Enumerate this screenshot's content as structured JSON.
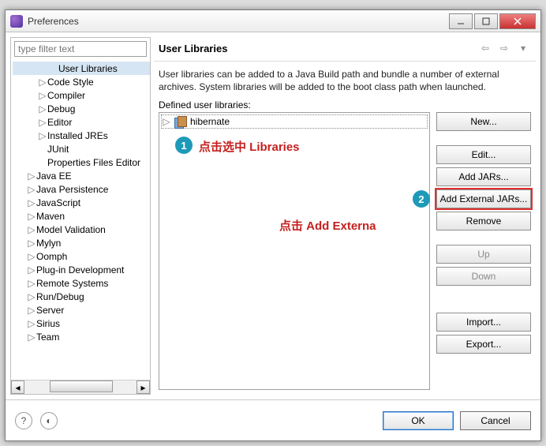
{
  "window": {
    "title": "Preferences"
  },
  "filter": {
    "placeholder": "type filter text"
  },
  "tree": {
    "items": [
      {
        "indent": 3,
        "tw": "",
        "label": "User Libraries",
        "sel": true
      },
      {
        "indent": 2,
        "tw": "▷",
        "label": "Code Style"
      },
      {
        "indent": 2,
        "tw": "▷",
        "label": "Compiler"
      },
      {
        "indent": 2,
        "tw": "▷",
        "label": "Debug"
      },
      {
        "indent": 2,
        "tw": "▷",
        "label": "Editor"
      },
      {
        "indent": 2,
        "tw": "▷",
        "label": "Installed JREs"
      },
      {
        "indent": 2,
        "tw": "",
        "label": "JUnit"
      },
      {
        "indent": 2,
        "tw": "",
        "label": "Properties Files Editor"
      },
      {
        "indent": 1,
        "tw": "▷",
        "label": "Java EE"
      },
      {
        "indent": 1,
        "tw": "▷",
        "label": "Java Persistence"
      },
      {
        "indent": 1,
        "tw": "▷",
        "label": "JavaScript"
      },
      {
        "indent": 1,
        "tw": "▷",
        "label": "Maven"
      },
      {
        "indent": 1,
        "tw": "▷",
        "label": "Model Validation"
      },
      {
        "indent": 1,
        "tw": "▷",
        "label": "Mylyn"
      },
      {
        "indent": 1,
        "tw": "▷",
        "label": "Oomph"
      },
      {
        "indent": 1,
        "tw": "▷",
        "label": "Plug-in Development"
      },
      {
        "indent": 1,
        "tw": "▷",
        "label": "Remote Systems"
      },
      {
        "indent": 1,
        "tw": "▷",
        "label": "Run/Debug"
      },
      {
        "indent": 1,
        "tw": "▷",
        "label": "Server"
      },
      {
        "indent": 1,
        "tw": "▷",
        "label": "Sirius"
      },
      {
        "indent": 1,
        "tw": "▷",
        "label": "Team"
      }
    ]
  },
  "page": {
    "title": "User Libraries",
    "description": "User libraries can be added to a Java Build path and bundle a number of external archives. System libraries will be added to the boot class path when launched.",
    "defined_label": "Defined user libraries:"
  },
  "library": {
    "name": "hibernate"
  },
  "buttons": {
    "new": "New...",
    "edit": "Edit...",
    "add_jars": "Add JARs...",
    "add_ext": "Add External JARs...",
    "remove": "Remove",
    "up": "Up",
    "down": "Down",
    "import": "Import...",
    "export": "Export..."
  },
  "footer": {
    "ok": "OK",
    "cancel": "Cancel",
    "help": "?"
  },
  "annotations": {
    "b1": "1",
    "t1": "点击选中 Libraries",
    "b2": "2",
    "t2": "点击 Add Externa"
  }
}
